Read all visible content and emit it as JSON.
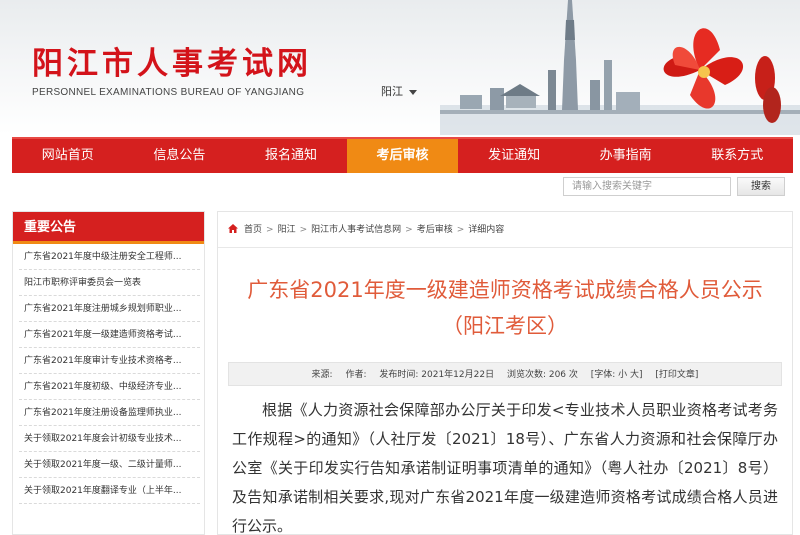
{
  "header": {
    "site_title": "阳江市人事考试网",
    "site_subtitle": "PERSONNEL EXAMINATIONS BUREAU OF YANGJIANG",
    "city": "阳江"
  },
  "nav": {
    "items": [
      "网站首页",
      "信息公告",
      "报名通知",
      "考后审核",
      "发证通知",
      "办事指南",
      "联系方式"
    ],
    "active_index": 3
  },
  "search": {
    "placeholder": "请输入搜索关键字",
    "button_label": "搜索"
  },
  "sidebar": {
    "title": "重要公告",
    "items": [
      "广东省2021年度中级注册安全工程师...",
      "阳江市职称评审委员会一览表",
      "广东省2021年度注册城乡规划师职业...",
      "广东省2021年度一级建造师资格考试...",
      "广东省2021年度审计专业技术资格考...",
      "广东省2021年度初级、中级经济专业...",
      "广东省2021年度注册设备监理师执业...",
      "关于领取2021年度会计初级专业技术...",
      "关于领取2021年度一级、二级计量师...",
      "关于领取2021年度翻译专业（上半年..."
    ]
  },
  "breadcrumb": [
    "首页",
    "阳江",
    "阳江市人事考试信息网",
    "考后审核",
    "详细内容"
  ],
  "article": {
    "title": "广东省2021年度一级建造师资格考试成绩合格人员公示（阳江考区）",
    "meta": {
      "source": "来源:",
      "author": "作者:",
      "publish_time": "发布时间: 2021年12月22日",
      "views": "浏览次数: 206 次",
      "font_size": "[字体: 小 大]",
      "print": "[打印文章]"
    },
    "body": "根据《人力资源社会保障部办公厅关于印发<专业技术人员职业资格考试考务工作规程>的通知》（人社厅发〔2021〕18号）、广东省人力资源和社会保障厅办公室《关于印发实行告知承诺制证明事项清单的通知》（粤人社办〔2021〕8号）及告知承诺制相关要求,现对广东省2021年度一级建造师资格考试成绩合格人员进行公示。"
  },
  "colors": {
    "brand_red": "#d5201f",
    "active_orange": "#f08a14",
    "title_orange": "#e05b3a"
  }
}
